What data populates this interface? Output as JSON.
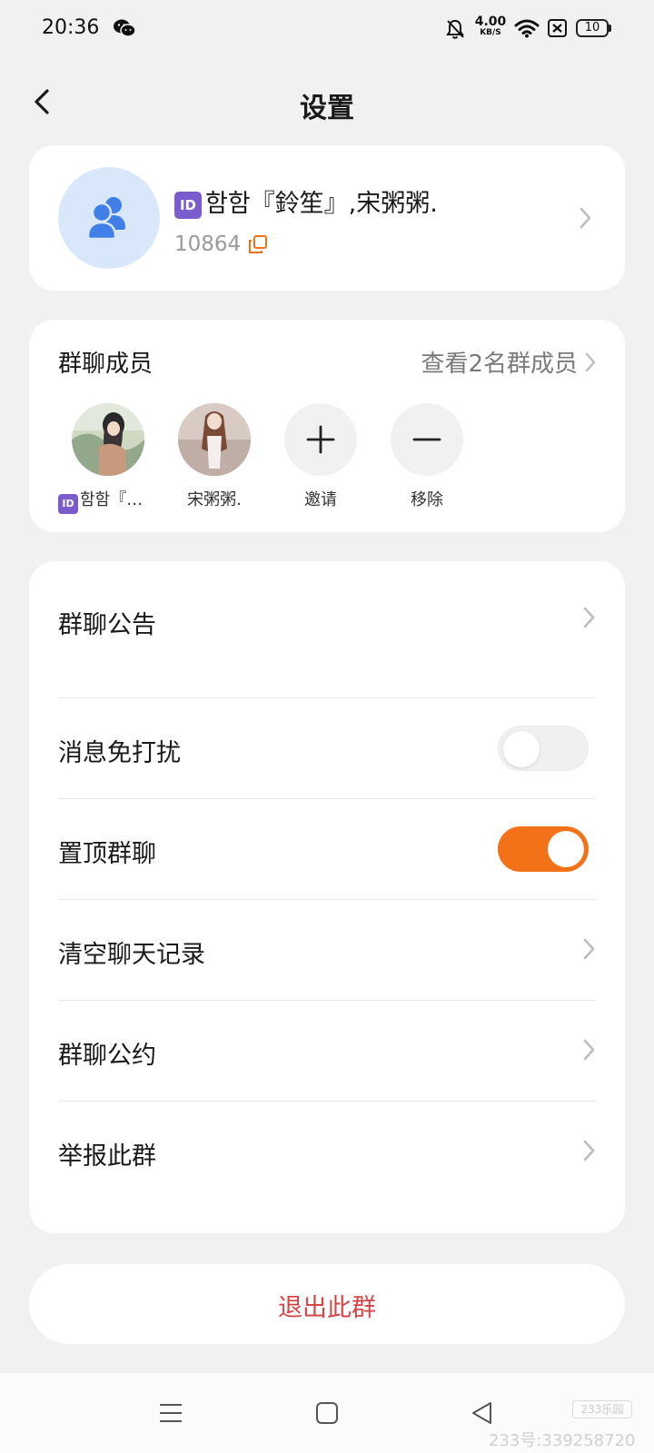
{
  "status_bar": {
    "time": "20:36",
    "net_speed_value": "4.00",
    "net_speed_unit": "KB/S",
    "battery": "10",
    "icons": [
      "wechat-icon",
      "mute-bell-icon",
      "wifi-icon",
      "sim-off-icon",
      "battery-icon"
    ]
  },
  "header": {
    "title": "设置",
    "back_icon": "chevron-left-icon"
  },
  "group": {
    "id_badge": "ID",
    "name": "함함『鈴笙』,宋粥粥.",
    "number": "10864",
    "avatar_icon": "group-users-icon",
    "copy_icon": "copy-icon"
  },
  "members": {
    "title": "群聊成员",
    "view_link": "查看2名群成员",
    "list": [
      {
        "badge": "ID",
        "name": "함함『鈴…"
      },
      {
        "name": "宋粥粥."
      }
    ],
    "invite_label": "邀请",
    "remove_label": "移除"
  },
  "settings": {
    "announcement": "群聊公告",
    "do_not_disturb": "消息免打扰",
    "do_not_disturb_on": false,
    "pin_chat": "置顶群聊",
    "pin_chat_on": true,
    "clear_history": "清空聊天记录",
    "group_rules": "群聊公约",
    "report": "举报此群"
  },
  "quit": {
    "label": "退出此群"
  },
  "colors": {
    "accent": "#f47217",
    "danger": "#d64545",
    "background": "#f1f1f3",
    "avatar_bg": "#d9e7fb",
    "avatar_icon": "#3f7fe6"
  },
  "watermark": {
    "logo": "233乐园",
    "text": "233号:339258720"
  }
}
